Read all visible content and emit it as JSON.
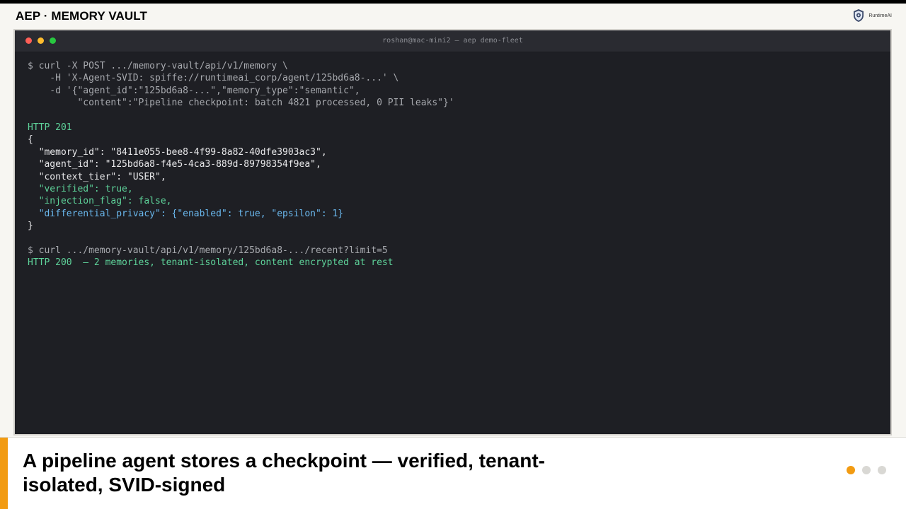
{
  "header": {
    "title": "AEP · MEMORY VAULT",
    "brand_name": "RuntimeAI",
    "brand_icon": "shield-logo-icon"
  },
  "terminal": {
    "window_title": "roshan@mac-mini2 — aep demo-fleet",
    "traffic_lights": {
      "close": "#ff5f57",
      "minimize": "#febc2e",
      "zoom": "#28c840"
    },
    "lines": [
      {
        "text": "$ curl -X POST .../memory-vault/api/v1/memory \\",
        "color": "gray"
      },
      {
        "text": "    -H 'X-Agent-SVID: spiffe://runtimeai_corp/agent/125bd6a8-...' \\",
        "color": "gray"
      },
      {
        "text": "    -d '{\"agent_id\":\"125bd6a8-...\",\"memory_type\":\"semantic\",",
        "color": "gray"
      },
      {
        "text": "         \"content\":\"Pipeline checkpoint: batch 4821 processed, 0 PII leaks\"}'",
        "color": "gray"
      },
      {
        "text": "",
        "color": "blank"
      },
      {
        "text": "HTTP 201",
        "color": "green"
      },
      {
        "text": "{",
        "color": "white"
      },
      {
        "text": "  \"memory_id\": \"8411e055-bee8-4f99-8a82-40dfe3903ac3\",",
        "color": "white"
      },
      {
        "text": "  \"agent_id\": \"125bd6a8-f4e5-4ca3-889d-89798354f9ea\",",
        "color": "white"
      },
      {
        "text": "  \"context_tier\": \"USER\",",
        "color": "white"
      },
      {
        "text": "  \"verified\": true,",
        "color": "green"
      },
      {
        "text": "  \"injection_flag\": false,",
        "color": "green"
      },
      {
        "text": "  \"differential_privacy\": {\"enabled\": true, \"epsilon\": 1}",
        "color": "blue"
      },
      {
        "text": "}",
        "color": "white"
      },
      {
        "text": "",
        "color": "blank"
      },
      {
        "text": "$ curl .../memory-vault/api/v1/memory/125bd6a8-.../recent?limit=5",
        "color": "gray"
      },
      {
        "text": "HTTP 200  — 2 memories, tenant-isolated, content encrypted at rest",
        "color": "green"
      }
    ]
  },
  "caption": {
    "text": "A pipeline agent stores a checkpoint — verified, tenant-isolated, SVID-signed"
  },
  "pager": {
    "total": 3,
    "active_index": 0,
    "active_color": "#f29b12"
  },
  "colors": {
    "accent": "#f29b12",
    "terminal_bg": "#1e1f24",
    "text_green": "#5ed39a",
    "text_blue": "#6ab8ee",
    "text_gray": "#a7a9ae"
  }
}
